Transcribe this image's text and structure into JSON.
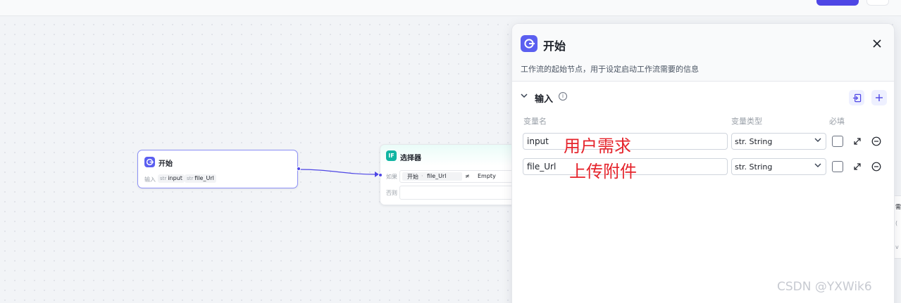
{
  "canvas": {
    "start_node": {
      "title": "开始",
      "input_label": "输入",
      "variables": [
        {
          "type": "str",
          "name": "input"
        },
        {
          "type": "str",
          "name": "file_Url"
        }
      ]
    },
    "selector_node": {
      "title": "选择器",
      "icon_text": "IF",
      "if_label": "如果",
      "condition": {
        "source": "开始",
        "var": "file_Url",
        "operator": "≠",
        "value": "Empty"
      },
      "else_label": "否则"
    }
  },
  "panel": {
    "title": "开始",
    "description": "工作流的起始节点，用于设定启动工作流需要的信息",
    "section_title": "输入",
    "columns": {
      "name": "变量名",
      "type": "变量类型",
      "required": "必填"
    },
    "rows": [
      {
        "name": "input",
        "type": "str. String",
        "annotation": "用户需求"
      },
      {
        "name": "file_Url",
        "type": "str. String",
        "annotation": "上传附件"
      }
    ]
  },
  "watermark": "CSDN @YXWik6",
  "colors": {
    "accent": "#4e46e5",
    "start_icon": "#5b5ff0",
    "selector_icon": "#0fb5a2",
    "annotation_red": "#e5232b"
  }
}
